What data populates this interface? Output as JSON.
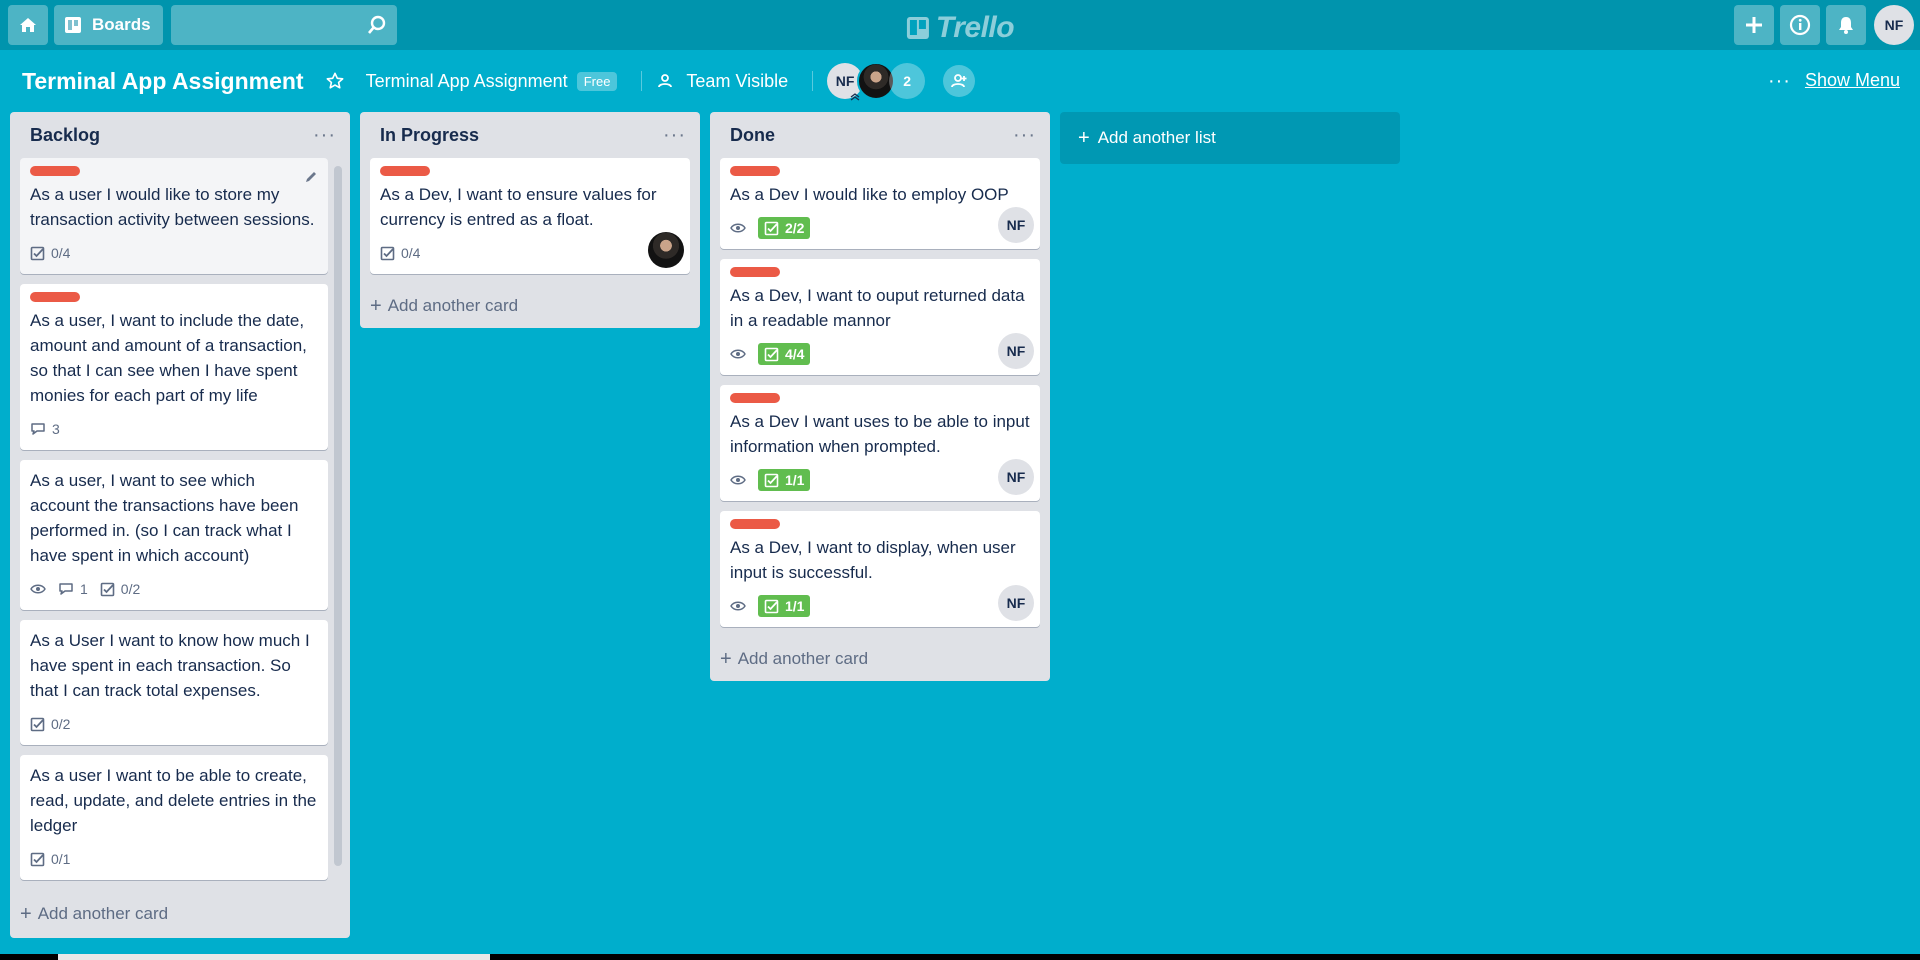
{
  "header": {
    "boards_label": "Boards",
    "search_placeholder": "",
    "logo_text": "Trello",
    "user_initials": "NF"
  },
  "board": {
    "title": "Terminal App Assignment",
    "team_name": "Terminal App Assignment",
    "plan_badge": "Free",
    "visibility": "Team Visible",
    "member_initials": "NF",
    "member_extra_count": "2",
    "show_menu_label": "Show Menu"
  },
  "lists": [
    {
      "title": "Backlog",
      "add_card_label": "Add another card",
      "cards": [
        {
          "text": "As a user I would like to store my transaction activity between sessions.",
          "label": true,
          "checklist": "0/4"
        },
        {
          "text": "As a user, I want to include the date, amount and amount of a transaction, so that I can see when I have spent monies for each part of my life",
          "label": true,
          "comments": "3"
        },
        {
          "text": "As a user, I want to see which account the transactions have been performed in. (so I can track what I have spent in which account)",
          "label": false,
          "watch": true,
          "comments": "1",
          "checklist": "0/2"
        },
        {
          "text": "As a User I want to know how much I have spent in each transaction. So that I can track total expenses.",
          "label": false,
          "checklist": "0/2"
        },
        {
          "text": "As a user I want to be able to create, read, update, and delete entries in the ledger",
          "label": false,
          "checklist": "0/1"
        }
      ]
    },
    {
      "title": "In Progress",
      "add_card_label": "Add another card",
      "cards": [
        {
          "text": "As a Dev, I want to ensure values for currency is entred as a float.",
          "label": true,
          "checklist": "0/4"
        }
      ]
    },
    {
      "title": "Done",
      "add_card_label": "Add another card",
      "cards": [
        {
          "text": "As a Dev I would like to employ OOP",
          "checklist": "2/2",
          "member": "NF"
        },
        {
          "text": "As a Dev, I want to ouput returned data in a readable mannor",
          "checklist": "4/4",
          "member": "NF"
        },
        {
          "text": "As a Dev I want uses to be able to input information when prompted.",
          "checklist": "1/1",
          "member": "NF"
        },
        {
          "text": "As a Dev, I want to display, when user input is successful.",
          "checklist": "1/1",
          "member": "NF"
        }
      ]
    }
  ],
  "add_list_label": "Add another list",
  "colors": {
    "background": "#00aecc",
    "label_red": "#eb5a46",
    "checklist_complete": "#61bd4f",
    "list_bg": "#dfe1e6"
  },
  "icons": [
    "home-icon",
    "boards-icon",
    "search-icon",
    "trello-logo-icon",
    "plus-icon",
    "info-icon",
    "bell-icon",
    "star-icon",
    "team-icon",
    "visibility-icon",
    "invite-icon",
    "more-icon",
    "edit-icon",
    "checklist-icon",
    "comment-icon",
    "watch-icon",
    "plus-small-icon"
  ]
}
